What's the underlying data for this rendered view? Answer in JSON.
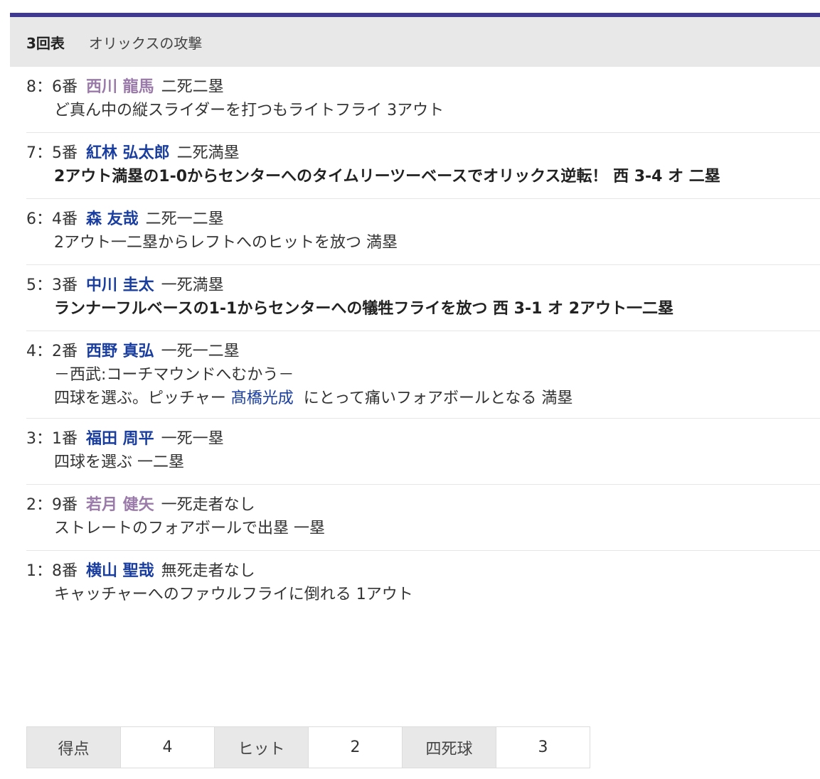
{
  "header": {
    "inning": "3回表",
    "attack": "オリックスの攻撃"
  },
  "colors": {
    "accent": "#3f3a8f",
    "player_blue": "#1a3ea0",
    "player_purple": "#9a7aa9"
  },
  "plays": [
    {
      "seq": "8：6番",
      "player": "西川 龍馬",
      "situation": "二死二塁",
      "desc": "ど真ん中の縦スライダーを打つもライトフライ 3アウト"
    },
    {
      "seq": "7：5番",
      "player": "紅林 弘太郎",
      "situation": "二死満塁",
      "desc": "2アウト満塁の1-0からセンターへのタイムリーツーベースでオリックス逆転！ 西 3-4 オ 二塁"
    },
    {
      "seq": "6：4番",
      "player": "森 友哉",
      "situation": "二死一二塁",
      "desc": "2アウト一二塁からレフトへのヒットを放つ 満塁"
    },
    {
      "seq": "5：3番",
      "player": "中川 圭太",
      "situation": "一死満塁",
      "desc": "ランナーフルベースの1-1からセンターへの犠牲フライを放つ 西 3-1 オ 2アウト一二塁"
    },
    {
      "seq": "4：2番",
      "player": "西野 真弘",
      "situation": "一死一二塁",
      "note": "－西武:コーチマウンドへむかう－",
      "desc_before": "四球を選ぶ。ピッチャー",
      "pitcher": "髙橋光成",
      "desc_after": "にとって痛いフォアボールとなる 満塁"
    },
    {
      "seq": "3：1番",
      "player": "福田 周平",
      "situation": "一死一塁",
      "desc": "四球を選ぶ 一二塁"
    },
    {
      "seq": "2：9番",
      "player": "若月 健矢",
      "situation": "一死走者なし",
      "desc": "ストレートのフォアボールで出塁 一塁"
    },
    {
      "seq": "1：8番",
      "player": "横山 聖哉",
      "situation": "無死走者なし",
      "desc": "キャッチャーへのファウルフライに倒れる 1アウト"
    }
  ],
  "summary": {
    "runs_label": "得点",
    "runs": "4",
    "hits_label": "ヒット",
    "hits": "2",
    "walks_label": "四死球",
    "walks": "3"
  }
}
